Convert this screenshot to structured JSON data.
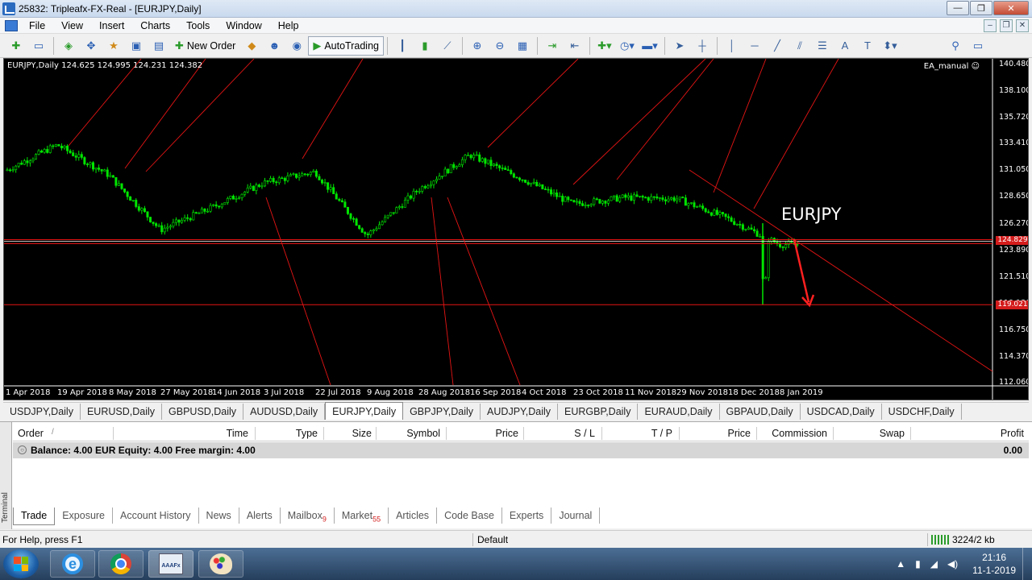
{
  "window": {
    "title": "25832: Tripleafx-FX-Real - [EURJPY,Daily]",
    "minimize": "—",
    "maximize": "❐",
    "close": "✕"
  },
  "menu": [
    "File",
    "View",
    "Insert",
    "Charts",
    "Tools",
    "Window",
    "Help"
  ],
  "mdi": {
    "minimize": "–",
    "restore": "❐",
    "close": "✕"
  },
  "toolbar": {
    "new_order": "New Order",
    "autotrading": "AutoTrading"
  },
  "chart": {
    "info": "EURJPY,Daily  124.625 124.995 124.231 124.382",
    "ea": "EA_manual ☺",
    "symbol": "EURJPY",
    "price_labels": [
      "140.480",
      "138.100",
      "135.720",
      "133.410",
      "131.050",
      "128.650",
      "126.270",
      "123.890",
      "121.510",
      "119.130",
      "116.750",
      "114.370",
      "112.060"
    ],
    "price_tags": [
      "124.829",
      "119.021"
    ],
    "date_labels": [
      "1 Apr 2018",
      "19 Apr 2018",
      "8 May 2018",
      "27 May 2018",
      "14 Jun 2018",
      "3 Jul 2018",
      "22 Jul 2018",
      "9 Aug 2018",
      "28 Aug 2018",
      "16 Sep 2018",
      "4 Oct 2018",
      "23 Oct 2018",
      "11 Nov 2018",
      "29 Nov 2018",
      "18 Dec 2018",
      "8 Jan 2019"
    ],
    "colors": {
      "background": "#000000",
      "candles": "#00e600",
      "lines": "#e61414",
      "arrow": "#ff2020"
    }
  },
  "chart_data": {
    "type": "line",
    "title": "EURJPY,Daily",
    "x": [
      "1 Apr 2018",
      "19 Apr 2018",
      "8 May 2018",
      "27 May 2018",
      "14 Jun 2018",
      "3 Jul 2018",
      "22 Jul 2018",
      "9 Aug 2018",
      "28 Aug 2018",
      "16 Sep 2018",
      "4 Oct 2018",
      "23 Oct 2018",
      "11 Nov 2018",
      "29 Nov 2018",
      "18 Dec 2018",
      "8 Jan 2019"
    ],
    "series": [
      {
        "name": "EURJPY",
        "values": [
          131.0,
          133.3,
          130.6,
          125.7,
          127.7,
          129.9,
          130.9,
          125.2,
          129.3,
          132.4,
          130.3,
          128.0,
          128.6,
          128.5,
          126.7,
          124.4
        ]
      }
    ],
    "ylim": [
      112.06,
      140.48
    ],
    "horizontal_levels": [
      124.829,
      119.021
    ]
  },
  "tabs": [
    "USDJPY,Daily",
    "EURUSD,Daily",
    "GBPUSD,Daily",
    "AUDUSD,Daily",
    "EURJPY,Daily",
    "GBPJPY,Daily",
    "AUDJPY,Daily",
    "EURGBP,Daily",
    "EURAUD,Daily",
    "GBPAUD,Daily",
    "USDCAD,Daily",
    "USDCHF,Daily"
  ],
  "terminal": {
    "side_label": "Terminal",
    "columns": [
      "Order",
      "Time",
      "Type",
      "Size",
      "Symbol",
      "Price",
      "S / L",
      "T / P",
      "Price",
      "Commission",
      "Swap",
      "Profit"
    ],
    "sort_marker": "/",
    "balance": "Balance: 4.00 EUR  Equity: 4.00  Free margin: 4.00",
    "profit": "0.00",
    "tabs": [
      {
        "label": "Trade",
        "badge": ""
      },
      {
        "label": "Exposure",
        "badge": ""
      },
      {
        "label": "Account History",
        "badge": ""
      },
      {
        "label": "News",
        "badge": ""
      },
      {
        "label": "Alerts",
        "badge": ""
      },
      {
        "label": "Mailbox",
        "badge": "9"
      },
      {
        "label": "Market",
        "badge": "55"
      },
      {
        "label": "Articles",
        "badge": ""
      },
      {
        "label": "Code Base",
        "badge": ""
      },
      {
        "label": "Experts",
        "badge": ""
      },
      {
        "label": "Journal",
        "badge": ""
      }
    ]
  },
  "status": {
    "help": "For Help, press F1",
    "profile": "Default",
    "connection": "3224/2 kb"
  },
  "taskbar": {
    "time": "21:16",
    "date": "11-1-2019",
    "mt_label": "AAAFx"
  }
}
